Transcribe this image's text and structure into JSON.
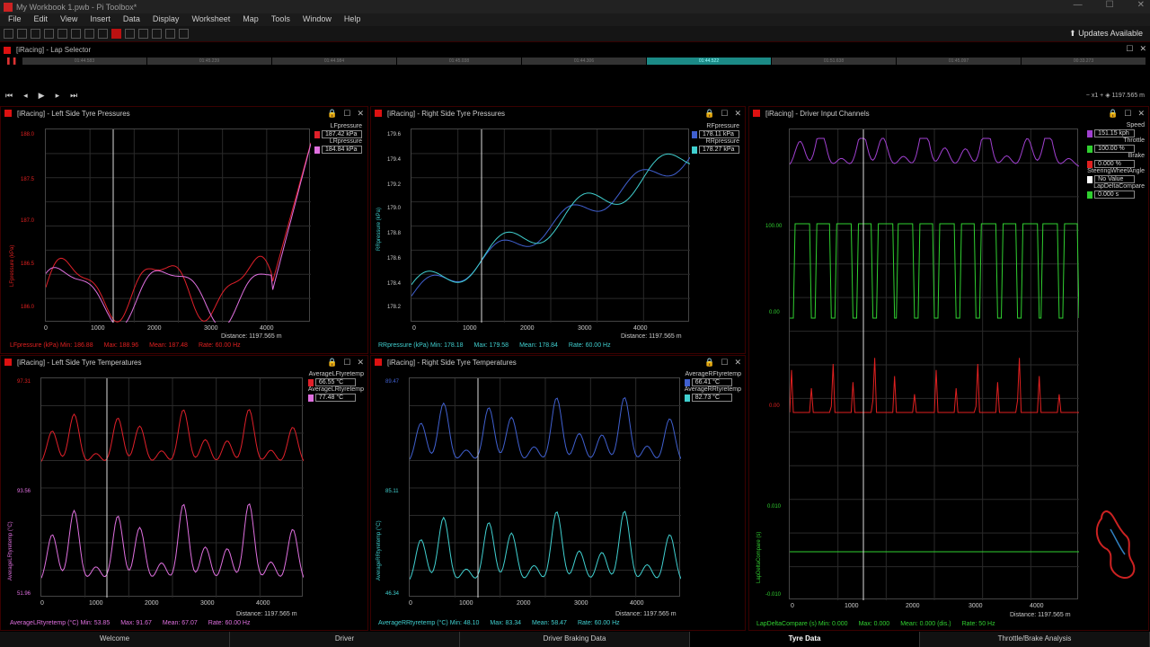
{
  "window": {
    "title": "My Workbook 1.pwb - Pi Toolbox*"
  },
  "menu": [
    "File",
    "Edit",
    "View",
    "Insert",
    "Data",
    "Display",
    "Worksheet",
    "Map",
    "Tools",
    "Window",
    "Help"
  ],
  "toolbar": {
    "updates": "Updates Available"
  },
  "lap_selector": {
    "title": "[iRacing] - Lap Selector",
    "laps": [
      "01:44.583",
      "01:45.239",
      "01:44.984",
      "01:45.038",
      "01:44.306",
      "01:44.522",
      "01:51.638",
      "01:45.097",
      "00:33.273"
    ],
    "active_index": 5
  },
  "player": {
    "speed": "x1",
    "distance": "1197.565 m"
  },
  "panels": {
    "left_pressures": {
      "title": "[iRacing] - Left Side Tyre Pressures",
      "legend": [
        {
          "name": "LFpressure",
          "value": "187.42 kPa",
          "color": "#e0202a"
        },
        {
          "name": "LRpressure",
          "value": "184.84 kPa",
          "color": "#e070e0"
        }
      ],
      "yticks": [
        "188.0",
        "187.5",
        "187.0",
        "186.5",
        "186.0"
      ],
      "ylabel": "LFpressure (kPa)",
      "stats": {
        "ch": "LFpressure (kPa) Min: 186.88",
        "max": "Max: 188.96",
        "mean": "Mean: 187.48",
        "rate": "Rate: 60.00 Hz"
      },
      "distance": "Distance: 1197.565 m"
    },
    "right_pressures": {
      "title": "[iRacing] - Right Side Tyre Pressures",
      "legend": [
        {
          "name": "RFpressure",
          "value": "178.11 kPa",
          "color": "#4060d0"
        },
        {
          "name": "RRpressure",
          "value": "178.27 kPa",
          "color": "#40d0d0"
        }
      ],
      "yticks": [
        "179.6",
        "179.4",
        "179.2",
        "179.0",
        "178.8",
        "178.6",
        "178.4",
        "178.2"
      ],
      "ylabel": "RRpressure (kPa)",
      "stats": {
        "ch": "RRpressure (kPa) Min: 178.18",
        "max": "Max: 179.58",
        "mean": "Mean: 178.84",
        "rate": "Rate: 60.00 Hz"
      },
      "distance": "Distance: 1197.565 m"
    },
    "left_temps": {
      "title": "[iRacing] - Left Side Tyre Temperatures",
      "legend": [
        {
          "name": "AverageLFtyretemp",
          "value": "66.55 °C",
          "color": "#e0202a"
        },
        {
          "name": "AverageLRtyretemp",
          "value": "77.48 °C",
          "color": "#e070e0"
        }
      ],
      "yticks": [
        "97.31",
        "93.56",
        "51.96"
      ],
      "ylabel": "AverageLRtyretemp (°C)",
      "stats": {
        "ch": "AverageLRtyretemp (°C) Min: 53.85",
        "max": "Max: 91.67",
        "mean": "Mean: 67.07",
        "rate": "Rate: 60.00 Hz"
      },
      "distance": "Distance: 1197.565 m"
    },
    "right_temps": {
      "title": "[iRacing] - Right Side Tyre Temperatures",
      "legend": [
        {
          "name": "AverageRFtyretemp",
          "value": "66.41 °C",
          "color": "#4060d0"
        },
        {
          "name": "AverageRRtyretemp",
          "value": "82.73 °C",
          "color": "#40d0d0"
        }
      ],
      "yticks": [
        "89.47",
        "85.11",
        "46.34"
      ],
      "ylabel": "AverageRRtyretemp (°C)",
      "stats": {
        "ch": "AverageRRtyretemp (°C) Min: 48.10",
        "max": "Max: 83.34",
        "mean": "Mean: 58.47",
        "rate": "Rate: 60.00 Hz"
      },
      "distance": "Distance: 1197.565 m"
    },
    "driver_inputs": {
      "title": "[iRacing] - Driver Input Channels",
      "legend": [
        {
          "name": "Speed",
          "value": "151.15 kph",
          "color": "#a040d0"
        },
        {
          "name": "Throttle",
          "value": "100.00 %",
          "color": "#30d030"
        },
        {
          "name": "Brake",
          "value": "0.000 %",
          "color": "#e02020"
        },
        {
          "name": "SteeringWheelAngle",
          "value": "No Value",
          "color": "#ffffff"
        },
        {
          "name": "LapDeltaCompare",
          "value": "0.000 s",
          "color": "#30d030"
        }
      ],
      "yticks": [
        "100.00",
        "0.00",
        "0.00",
        "0.010",
        "-0.010"
      ],
      "ylabel": "LapDeltaCompare (s)",
      "stats": {
        "ch": "LapDeltaCompare (s) Min: 0.000",
        "max": "Max: 0.000",
        "mean": "Mean: 0.000 (dis.)",
        "rate": "Rate: 50 Hz"
      },
      "distance": "Distance: 1197.565 m"
    }
  },
  "xticks": [
    "0",
    "1000",
    "2000",
    "3000",
    "4000"
  ],
  "tabs": [
    "Welcome",
    "Driver",
    "Driver Braking Data",
    "Tyre Data",
    "Throttle/Brake Analysis"
  ],
  "active_tab": "Tyre Data"
}
